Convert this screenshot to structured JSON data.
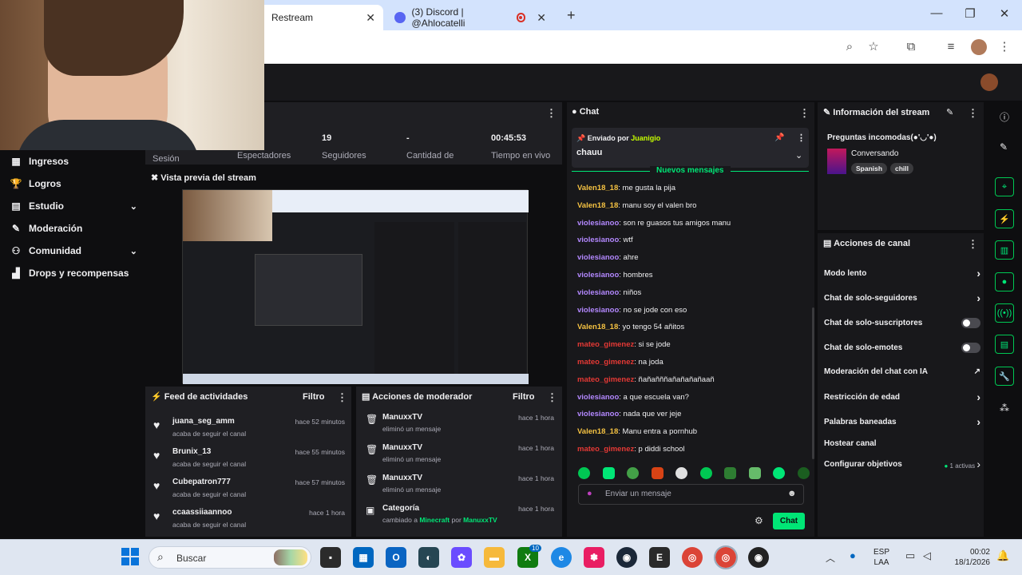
{
  "browser": {
    "tab1_title": "Restream",
    "tab2_title": "(3) Discord | @Ahlocatelli",
    "new_tab": "+",
    "close_glyph": "✕"
  },
  "stats": {
    "session_label": "Sesión",
    "viewers_label": "Espectadores",
    "followers_value": "19",
    "followers_label": "Seguidores",
    "amount_value": "-",
    "amount_label": "Cantidad de",
    "live_time_value": "00:45:53",
    "live_time_label": "Tiempo en vivo"
  },
  "nav": {
    "items": [
      {
        "label": "Ingresos",
        "icon": "money-icon"
      },
      {
        "label": "Logros",
        "icon": "trophy-icon"
      },
      {
        "label": "Estudio",
        "icon": "studio-icon"
      },
      {
        "label": "Moderación",
        "icon": "wrench-icon"
      },
      {
        "label": "Comunidad",
        "icon": "community-icon"
      },
      {
        "label": "Drops y recompensas",
        "icon": "drops-icon"
      }
    ]
  },
  "preview": {
    "title": "Vista previa del stream"
  },
  "activity": {
    "title": "Feed de actividades",
    "filter": "Filtro",
    "items": [
      {
        "name": "juana_seg_amm",
        "sub": "acaba de seguir el canal",
        "time": "hace 52 minutos"
      },
      {
        "name": "Brunix_13",
        "sub": "acaba de seguir el canal",
        "time": "hace 55 minutos"
      },
      {
        "name": "Cubepatron777",
        "sub": "acaba de seguir el canal",
        "time": "hace 57 minutos"
      },
      {
        "name": "ccaassiiaannoo",
        "sub": "acaba de seguir el canal",
        "time": "hace 1 hora"
      }
    ]
  },
  "modactions": {
    "title": "Acciones de moderador",
    "filter": "Filtro",
    "items": [
      {
        "name": "ManuxxTV",
        "sub": "eliminó un mensaje",
        "time": "hace 1 hora"
      },
      {
        "name": "ManuxxTV",
        "sub": "eliminó un mensaje",
        "time": "hace 1 hora"
      },
      {
        "name": "ManuxxTV",
        "sub": "eliminó un mensaje",
        "time": "hace 1 hora"
      }
    ],
    "category": {
      "name": "Categoría",
      "prefix": "cambiado a",
      "game": "Minecraft",
      "by": "por",
      "user": "ManuxxTV",
      "time": "hace 1 hora"
    }
  },
  "chat": {
    "title": "Chat",
    "pinned_prefix": "Enviado por",
    "pinned_user": "Juanigio",
    "pinned_msg": "chauu",
    "new_messages": "Nuevos mensajes",
    "messages": [
      {
        "user": "Valen18_18",
        "color": "#f5c242",
        "text": ": me gusta la pija"
      },
      {
        "user": "Valen18_18",
        "color": "#f5c242",
        "text": ": manu soy el valen bro"
      },
      {
        "user": "violesianoo",
        "color": "#b388ff",
        "text": ": son re guasos tus amigos manu"
      },
      {
        "user": "violesianoo",
        "color": "#b388ff",
        "text": ": wtf"
      },
      {
        "user": "violesianoo",
        "color": "#b388ff",
        "text": ": ahre"
      },
      {
        "user": "violesianoo",
        "color": "#b388ff",
        "text": ": hombres"
      },
      {
        "user": "violesianoo",
        "color": "#b388ff",
        "text": ": niños"
      },
      {
        "user": "violesianoo",
        "color": "#b388ff",
        "text": ": no se jode con eso"
      },
      {
        "user": "Valen18_18",
        "color": "#f5c242",
        "text": ": yo tengo 54 añitos"
      },
      {
        "user": "mateo_gimenez",
        "color": "#e53935",
        "text": ": si se jode"
      },
      {
        "user": "mateo_gimenez",
        "color": "#e53935",
        "text": ": na joda"
      },
      {
        "user": "mateo_gimenez",
        "color": "#e53935",
        "text": ": ñañañññañañañañaañ"
      },
      {
        "user": "violesianoo",
        "color": "#b388ff",
        "text": ": a que escuela van?"
      },
      {
        "user": "violesianoo",
        "color": "#b388ff",
        "text": ": nada que ver jeje"
      },
      {
        "user": "Valen18_18",
        "color": "#f5c242",
        "text": ": Manu entra a pornhub"
      },
      {
        "user": "mateo_gimenez",
        "color": "#e53935",
        "text": ": p diddi school"
      }
    ],
    "input_placeholder": "Enviar un mensaje",
    "send_label": "Chat"
  },
  "stream_info": {
    "title": "Información del stream",
    "stream_title": "Preguntas incomodas(●'◡'●)",
    "category": "Conversando",
    "tags": [
      "Spanish",
      "chill"
    ]
  },
  "channel_actions": {
    "title": "Acciones de canal",
    "items": [
      {
        "label": "Modo lento",
        "kind": "chevron"
      },
      {
        "label": "Chat de solo-seguidores",
        "kind": "chevron"
      },
      {
        "label": "Chat de solo-suscriptores",
        "kind": "toggle"
      },
      {
        "label": "Chat de solo-emotes",
        "kind": "toggle"
      },
      {
        "label": "Moderación del chat con IA",
        "kind": "external"
      },
      {
        "label": "Restricción de edad",
        "kind": "chevron"
      },
      {
        "label": "Palabras baneadas",
        "kind": "chevron"
      },
      {
        "label": "Hostear canal",
        "kind": "none"
      },
      {
        "label": "Configurar objetivos",
        "kind": "goals",
        "extra": "1 activas"
      }
    ]
  },
  "taskbar": {
    "search": "Buscar",
    "lang_line1": "ESP",
    "lang_line2": "LAA",
    "time": "00:02",
    "date": "18/1/2026",
    "badge": "10"
  },
  "colors": {
    "accent": "#00e676",
    "bg": "#0e0e10",
    "panel": "#1f1f23"
  }
}
